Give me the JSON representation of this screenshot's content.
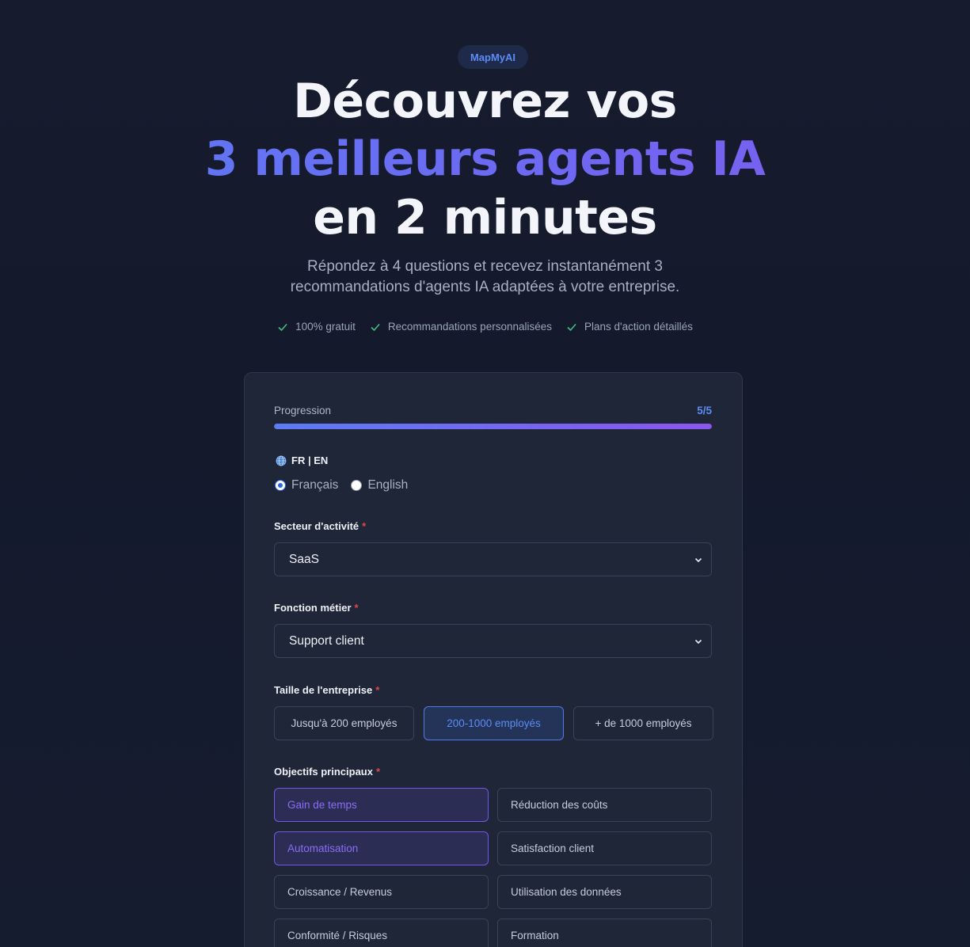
{
  "brand": "MapMyAI",
  "hero": {
    "line1": "Découvrez vos",
    "line2": "3 meilleurs agents IA",
    "line3": "en 2 minutes"
  },
  "subtitle": {
    "line1": "Répondez à 4 questions et recevez instantanément 3",
    "line2": "recommandations d'agents IA adaptées à votre entreprise."
  },
  "features": [
    "100% gratuit",
    "Recommandations personnalisées",
    "Plans d'action détaillés"
  ],
  "progress": {
    "label": "Progression",
    "count": "5/5",
    "fraction": 1.0
  },
  "language": {
    "title": "FR | EN",
    "options": [
      "Français",
      "English"
    ],
    "selected": "Français"
  },
  "sector": {
    "label": "Secteur d'activité",
    "required": "*",
    "value": "SaaS"
  },
  "function": {
    "label": "Fonction métier",
    "required": "*",
    "value": "Support client"
  },
  "size": {
    "label": "Taille de l'entreprise",
    "required": "*",
    "options": [
      "Jusqu'à 200 employés",
      "200-1000 employés",
      "+ de 1000 employés"
    ],
    "selected": "200-1000 employés"
  },
  "objectives": {
    "label": "Objectifs principaux",
    "required": "*",
    "options": [
      "Gain de temps",
      "Réduction des coûts",
      "Automatisation",
      "Satisfaction client",
      "Croissance / Revenus",
      "Utilisation des données",
      "Conformité / Risques",
      "Formation"
    ],
    "selected": [
      "Gain de temps",
      "Automatisation"
    ]
  },
  "colors": {
    "accent_blue": "#5b8cf5",
    "accent_purple": "#8b6cf5",
    "check_green": "#3fbf7f",
    "required_red": "#e0464a"
  }
}
